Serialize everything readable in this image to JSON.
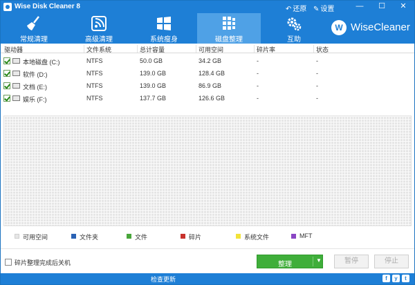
{
  "titlebar": {
    "title": "Wise Disk Cleaner 8",
    "restore_label": "还原",
    "settings_label": "设置"
  },
  "toolbar": {
    "tabs": [
      {
        "label": "常规清理",
        "icon": "broom-icon"
      },
      {
        "label": "高级清理",
        "icon": "radar-icon"
      },
      {
        "label": "系统瘦身",
        "icon": "windows-icon"
      },
      {
        "label": "磁盘整理",
        "icon": "blocks-icon",
        "active": true
      },
      {
        "label": "互助",
        "icon": "gears-icon"
      }
    ],
    "brand_logo": "W",
    "brand_name": "WiseCleaner"
  },
  "table": {
    "headers": [
      "驱动器",
      "文件系统",
      "总计容量",
      "可用空间",
      "碎片率",
      "状态"
    ],
    "rows": [
      {
        "drive": "本地磁盘 (C:)",
        "fs": "NTFS",
        "total": "50.0 GB",
        "free": "34.2 GB",
        "frag": "-",
        "status": "-",
        "checked": true
      },
      {
        "drive": "软件 (D:)",
        "fs": "NTFS",
        "total": "139.0 GB",
        "free": "128.4 GB",
        "frag": "-",
        "status": "-",
        "checked": true
      },
      {
        "drive": "文档 (E:)",
        "fs": "NTFS",
        "total": "139.0 GB",
        "free": "86.9 GB",
        "frag": "-",
        "status": "-",
        "checked": true
      },
      {
        "drive": "娱乐 (F:)",
        "fs": "NTFS",
        "total": "137.7 GB",
        "free": "126.6 GB",
        "frag": "-",
        "status": "-",
        "checked": true
      }
    ]
  },
  "legend": [
    {
      "label": "可用空间",
      "color": "#e6e6e6"
    },
    {
      "label": "文件夹",
      "color": "#2a62b4"
    },
    {
      "label": "文件",
      "color": "#48a63a"
    },
    {
      "label": "碎片",
      "color": "#c8312c"
    },
    {
      "label": "系统文件",
      "color": "#f2e33a"
    },
    {
      "label": "MFT",
      "color": "#8a46c4"
    }
  ],
  "controls": {
    "shutdown_label": "碎片整理完成后关机",
    "defrag_label": "整理",
    "pause_label": "暂停",
    "stop_label": "停止"
  },
  "statusbar": {
    "check_update": "检查更新",
    "social": [
      "f",
      "y",
      "t"
    ]
  },
  "colors": {
    "accent": "#1e7fd6",
    "active_tab": "#4fa1e6",
    "primary_button": "#3fae3a"
  }
}
